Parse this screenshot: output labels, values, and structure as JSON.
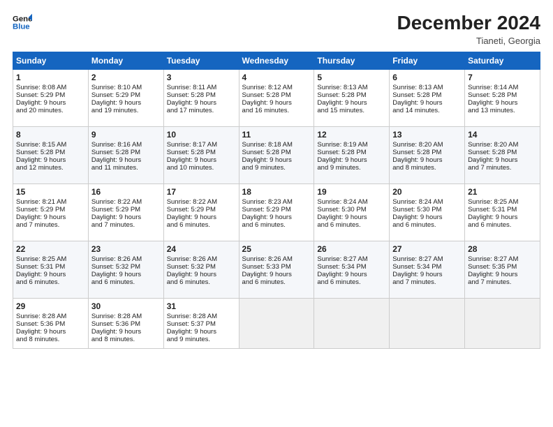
{
  "logo": {
    "line1": "General",
    "line2": "Blue"
  },
  "title": "December 2024",
  "location": "Tianeti, Georgia",
  "weekdays": [
    "Sunday",
    "Monday",
    "Tuesday",
    "Wednesday",
    "Thursday",
    "Friday",
    "Saturday"
  ],
  "weeks": [
    [
      {
        "day": "1",
        "lines": [
          "Sunrise: 8:08 AM",
          "Sunset: 5:29 PM",
          "Daylight: 9 hours",
          "and 20 minutes."
        ]
      },
      {
        "day": "2",
        "lines": [
          "Sunrise: 8:10 AM",
          "Sunset: 5:29 PM",
          "Daylight: 9 hours",
          "and 19 minutes."
        ]
      },
      {
        "day": "3",
        "lines": [
          "Sunrise: 8:11 AM",
          "Sunset: 5:28 PM",
          "Daylight: 9 hours",
          "and 17 minutes."
        ]
      },
      {
        "day": "4",
        "lines": [
          "Sunrise: 8:12 AM",
          "Sunset: 5:28 PM",
          "Daylight: 9 hours",
          "and 16 minutes."
        ]
      },
      {
        "day": "5",
        "lines": [
          "Sunrise: 8:13 AM",
          "Sunset: 5:28 PM",
          "Daylight: 9 hours",
          "and 15 minutes."
        ]
      },
      {
        "day": "6",
        "lines": [
          "Sunrise: 8:13 AM",
          "Sunset: 5:28 PM",
          "Daylight: 9 hours",
          "and 14 minutes."
        ]
      },
      {
        "day": "7",
        "lines": [
          "Sunrise: 8:14 AM",
          "Sunset: 5:28 PM",
          "Daylight: 9 hours",
          "and 13 minutes."
        ]
      }
    ],
    [
      {
        "day": "8",
        "lines": [
          "Sunrise: 8:15 AM",
          "Sunset: 5:28 PM",
          "Daylight: 9 hours",
          "and 12 minutes."
        ]
      },
      {
        "day": "9",
        "lines": [
          "Sunrise: 8:16 AM",
          "Sunset: 5:28 PM",
          "Daylight: 9 hours",
          "and 11 minutes."
        ]
      },
      {
        "day": "10",
        "lines": [
          "Sunrise: 8:17 AM",
          "Sunset: 5:28 PM",
          "Daylight: 9 hours",
          "and 10 minutes."
        ]
      },
      {
        "day": "11",
        "lines": [
          "Sunrise: 8:18 AM",
          "Sunset: 5:28 PM",
          "Daylight: 9 hours",
          "and 9 minutes."
        ]
      },
      {
        "day": "12",
        "lines": [
          "Sunrise: 8:19 AM",
          "Sunset: 5:28 PM",
          "Daylight: 9 hours",
          "and 9 minutes."
        ]
      },
      {
        "day": "13",
        "lines": [
          "Sunrise: 8:20 AM",
          "Sunset: 5:28 PM",
          "Daylight: 9 hours",
          "and 8 minutes."
        ]
      },
      {
        "day": "14",
        "lines": [
          "Sunrise: 8:20 AM",
          "Sunset: 5:28 PM",
          "Daylight: 9 hours",
          "and 7 minutes."
        ]
      }
    ],
    [
      {
        "day": "15",
        "lines": [
          "Sunrise: 8:21 AM",
          "Sunset: 5:29 PM",
          "Daylight: 9 hours",
          "and 7 minutes."
        ]
      },
      {
        "day": "16",
        "lines": [
          "Sunrise: 8:22 AM",
          "Sunset: 5:29 PM",
          "Daylight: 9 hours",
          "and 7 minutes."
        ]
      },
      {
        "day": "17",
        "lines": [
          "Sunrise: 8:22 AM",
          "Sunset: 5:29 PM",
          "Daylight: 9 hours",
          "and 6 minutes."
        ]
      },
      {
        "day": "18",
        "lines": [
          "Sunrise: 8:23 AM",
          "Sunset: 5:29 PM",
          "Daylight: 9 hours",
          "and 6 minutes."
        ]
      },
      {
        "day": "19",
        "lines": [
          "Sunrise: 8:24 AM",
          "Sunset: 5:30 PM",
          "Daylight: 9 hours",
          "and 6 minutes."
        ]
      },
      {
        "day": "20",
        "lines": [
          "Sunrise: 8:24 AM",
          "Sunset: 5:30 PM",
          "Daylight: 9 hours",
          "and 6 minutes."
        ]
      },
      {
        "day": "21",
        "lines": [
          "Sunrise: 8:25 AM",
          "Sunset: 5:31 PM",
          "Daylight: 9 hours",
          "and 6 minutes."
        ]
      }
    ],
    [
      {
        "day": "22",
        "lines": [
          "Sunrise: 8:25 AM",
          "Sunset: 5:31 PM",
          "Daylight: 9 hours",
          "and 6 minutes."
        ]
      },
      {
        "day": "23",
        "lines": [
          "Sunrise: 8:26 AM",
          "Sunset: 5:32 PM",
          "Daylight: 9 hours",
          "and 6 minutes."
        ]
      },
      {
        "day": "24",
        "lines": [
          "Sunrise: 8:26 AM",
          "Sunset: 5:32 PM",
          "Daylight: 9 hours",
          "and 6 minutes."
        ]
      },
      {
        "day": "25",
        "lines": [
          "Sunrise: 8:26 AM",
          "Sunset: 5:33 PM",
          "Daylight: 9 hours",
          "and 6 minutes."
        ]
      },
      {
        "day": "26",
        "lines": [
          "Sunrise: 8:27 AM",
          "Sunset: 5:34 PM",
          "Daylight: 9 hours",
          "and 6 minutes."
        ]
      },
      {
        "day": "27",
        "lines": [
          "Sunrise: 8:27 AM",
          "Sunset: 5:34 PM",
          "Daylight: 9 hours",
          "and 7 minutes."
        ]
      },
      {
        "day": "28",
        "lines": [
          "Sunrise: 8:27 AM",
          "Sunset: 5:35 PM",
          "Daylight: 9 hours",
          "and 7 minutes."
        ]
      }
    ],
    [
      {
        "day": "29",
        "lines": [
          "Sunrise: 8:28 AM",
          "Sunset: 5:36 PM",
          "Daylight: 9 hours",
          "and 8 minutes."
        ]
      },
      {
        "day": "30",
        "lines": [
          "Sunrise: 8:28 AM",
          "Sunset: 5:36 PM",
          "Daylight: 9 hours",
          "and 8 minutes."
        ]
      },
      {
        "day": "31",
        "lines": [
          "Sunrise: 8:28 AM",
          "Sunset: 5:37 PM",
          "Daylight: 9 hours",
          "and 9 minutes."
        ]
      },
      null,
      null,
      null,
      null
    ]
  ]
}
